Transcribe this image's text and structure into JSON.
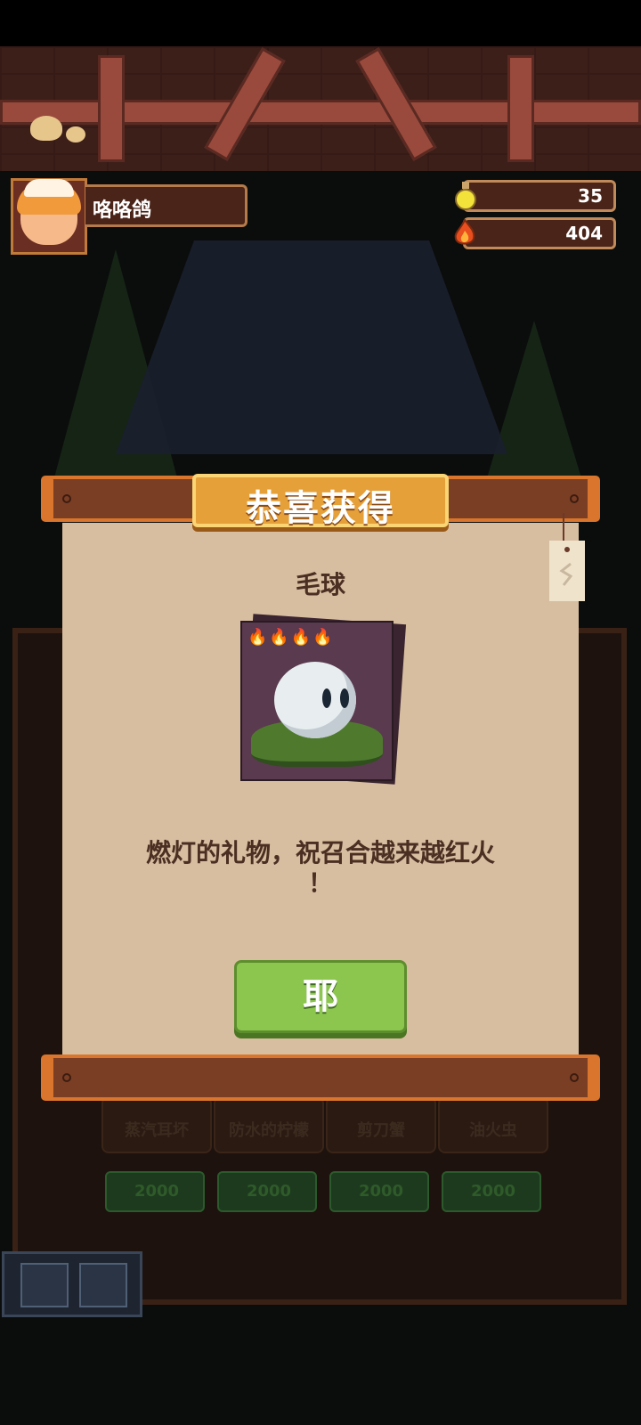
{
  "player": {
    "name": "咯咯鸽"
  },
  "resources": {
    "potion": "35",
    "fire": "404"
  },
  "dialog": {
    "title": "恭喜获得",
    "item_name": "毛球",
    "item_flames": "🔥🔥🔥🔥",
    "description_line1": "燃灯的礼物，祝召合越来越红火",
    "description_line2": "！",
    "confirm_label": "耶"
  },
  "background_shop": {
    "items": [
      {
        "label": "蒸汽耳坏",
        "cost": "2000"
      },
      {
        "label": "防水的柠檬",
        "cost": "2000"
      },
      {
        "label": "剪刀蟹",
        "cost": "2000"
      },
      {
        "label": "油火虫",
        "cost": "2000"
      }
    ]
  }
}
